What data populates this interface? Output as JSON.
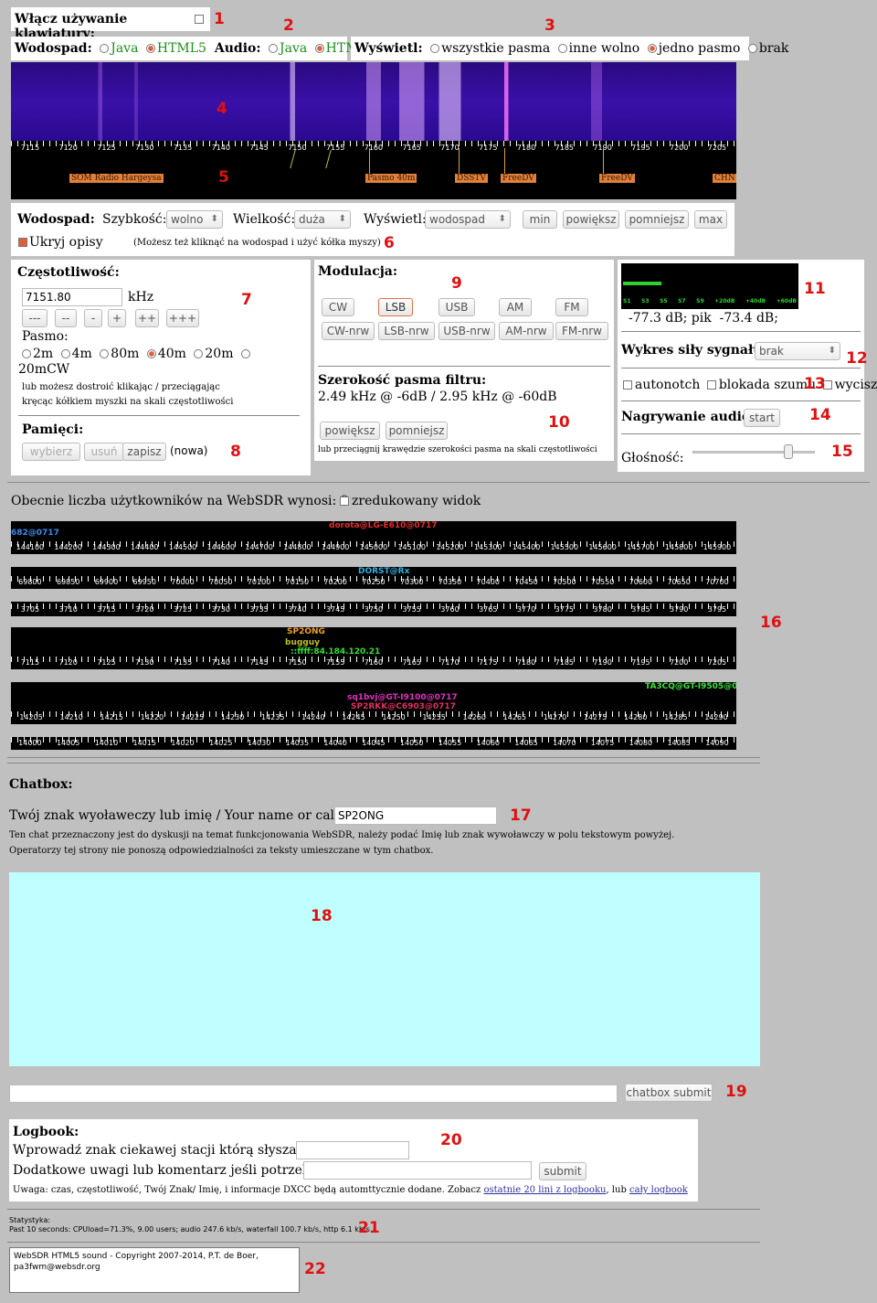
{
  "keyboard": {
    "label": "Włącz używanie klawiatury:"
  },
  "render": {
    "waterfall_label": "Wodospad:",
    "java": "Java",
    "html5": "HTML5",
    "audio_label": "Audio:"
  },
  "display": {
    "label": "Wyświetl:",
    "opts": [
      "wszystkie pasma",
      "inne wolno",
      "jedno pasmo",
      "brak"
    ]
  },
  "waterfall": {
    "ticks": [
      "7115",
      "7120",
      "7125",
      "7130",
      "7135",
      "7140",
      "7145",
      "7150",
      "7155",
      "7160",
      "7165",
      "7170",
      "7175",
      "7180",
      "7185",
      "7190",
      "7195",
      "7200",
      "7205"
    ],
    "labels": [
      "SOM Radio Hargeysa",
      "Pasmo 40m",
      "DSSTV",
      "FreeDV",
      "FreeDV",
      "CHN PBS Xinjiang"
    ]
  },
  "wf_settings": {
    "title": "Wodospad:",
    "speed_label": "Szybkość:",
    "speed": "wolno",
    "size_label": "Wielkość:",
    "size": "duża",
    "show_label": "Wyświetl:",
    "show": "wodospad",
    "btns": [
      "min",
      "powiększ",
      "pomniejsz",
      "max"
    ],
    "hide": "Ukryj opisy",
    "hint": "(Możesz też kliknąć na wodospad i użyć kółka myszy)"
  },
  "freq": {
    "title": "Częstotliwość:",
    "value": "7151.80",
    "unit": "kHz",
    "steps": [
      "---",
      "--",
      "-",
      "+",
      "++",
      "+++"
    ],
    "band_label": "Pasmo:",
    "bands": [
      "2m",
      "4m",
      "80m",
      "40m",
      "20m",
      "20mCW"
    ],
    "hint1": "lub możesz dostroić klikając / przeciągając",
    "hint2": "kręcąc kółkiem myszki na skali częstotliwości",
    "mem_title": "Pamięci:",
    "mem_btns": [
      "wybierz",
      "usuń",
      "zapisz"
    ],
    "mem_new": "(nowa)"
  },
  "mod": {
    "title": "Modulacja:",
    "row1": [
      "CW",
      "LSB",
      "USB",
      "AM",
      "FM"
    ],
    "row2": [
      "CW-nrw",
      "LSB-nrw",
      "USB-nrw",
      "AM-nrw",
      "FM-nrw"
    ],
    "bw_title": "Szerokość pasma filtru:",
    "bw_value": "2.49 kHz @ -6dB / 2.95 kHz @ -60dB",
    "bw_btns": [
      "powiększ",
      "pomniejsz"
    ],
    "bw_hint": "lub przeciągnij krawędzie szerokości pasma na skali częstotliwości"
  },
  "meter": {
    "scale": [
      "S1",
      "S3",
      "S5",
      "S7",
      "S9",
      "+20dB",
      "+40dB",
      "+60dB"
    ],
    "reading": "-77.3 dB; pik  -73.4 dB;",
    "level": 0.22
  },
  "signal": {
    "label": "Wykres siły sygnału:",
    "value": "brak",
    "autonotch": "autonotch",
    "nb": "blokada szumu",
    "mute": "wycisz",
    "rec_label": "Nagrywanie audio:",
    "rec_btn": "start",
    "vol_label": "Głośność:",
    "volume": 0.78
  },
  "users": {
    "text": "Obecnie liczba użytkowników na WebSDR wynosi: 9",
    "reduced": "zredukowany widok"
  },
  "bands": [
    {
      "ticks": [
        "144100",
        "144200",
        "144300",
        "144400",
        "144500",
        "144600",
        "144700",
        "144800",
        "144900",
        "145000",
        "145100",
        "145200",
        "145300",
        "145400",
        "145500",
        "145600",
        "145700",
        "145800",
        "145900"
      ],
      "users": [
        {
          "t": "682@0717",
          "c": "#3a8ef0"
        },
        {
          "t": "dorota@LG-E610@0717",
          "c": "#e03030"
        }
      ]
    },
    {
      "ticks": [
        "69800",
        "69850",
        "69900",
        "69950",
        "70000",
        "70050",
        "70100",
        "70150",
        "70200",
        "70250",
        "70300",
        "70350",
        "70400",
        "70450",
        "70500",
        "70550",
        "70600",
        "70650",
        "70700"
      ],
      "users": [
        {
          "t": "DORST@Rx",
          "c": "#30b0e0"
        }
      ]
    },
    {
      "ticks": [
        "3705",
        "3710",
        "3715",
        "3720",
        "3725",
        "3730",
        "3735",
        "3740",
        "3745",
        "3750",
        "3755",
        "3760",
        "3765",
        "3770",
        "3775",
        "3780",
        "3785",
        "3790",
        "3795"
      ],
      "users": []
    },
    {
      "ticks": [
        "7115",
        "7120",
        "7125",
        "7130",
        "7135",
        "7140",
        "7145",
        "7150",
        "7155",
        "7160",
        "7165",
        "7170",
        "7175",
        "7180",
        "7185",
        "7190",
        "7195",
        "7200",
        "7205"
      ],
      "users": [
        {
          "t": "SP2ONG",
          "c": "#f0a020"
        },
        {
          "t": "bugguy",
          "c": "#c0c020"
        },
        {
          "t": "::ffff:84.184.120.21",
          "c": "#30e030"
        }
      ]
    },
    {
      "ticks": [
        "14205",
        "14210",
        "14215",
        "14220",
        "14225",
        "14230",
        "14235",
        "14240",
        "14245",
        "14250",
        "14255",
        "14260",
        "14265",
        "14270",
        "14275",
        "14280",
        "14285",
        "14290"
      ],
      "users": [
        {
          "t": "TA3CQ@GT-I9505@0717",
          "c": "#40e040"
        },
        {
          "t": "sq1bvj@GT-I9100@0717",
          "c": "#e030c0"
        },
        {
          "t": "SP2RKK@C6903@0717",
          "c": "#e03060"
        }
      ]
    },
    {
      "ticks": [
        "14000",
        "14005",
        "14010",
        "14015",
        "14020",
        "14025",
        "14030",
        "14035",
        "14040",
        "14045",
        "14050",
        "14055",
        "14060",
        "14065",
        "14070",
        "14075",
        "14080",
        "14085",
        "14090"
      ],
      "users": []
    }
  ],
  "chat": {
    "title": "Chatbox:",
    "name_label": "Twój znak wyoławeczy lub imię / Your name or callsign:",
    "name_value": "SP2ONG",
    "note1": "Ten chat przeznaczony jest do dyskusji na temat funkcjonowania WebSDR, należy podać Imię lub znak wywoławczy w polu tekstowym powyżej.",
    "note2": "Operatorzy tej strony nie ponoszą odpowiedzialności za teksty umieszczane w tym chatbox.",
    "submit": "chatbox submit"
  },
  "logbook": {
    "title": "Logbook:",
    "station_label": "Wprowadź znak ciekawej stacji którą słyszałeś:",
    "comment_label": "Dodatkowe uwagi lub komentarz jeśli potrzebny:",
    "submit": "submit",
    "note": "Uwaga: czas, częstotliwość, Twój Znak/ Imię, i informacje DXCC będą automttycznie dodane. Zobacz",
    "link1": "ostatnie 20 lini z logbooku",
    "or": ", lub",
    "link2": "cały logbook"
  },
  "stats": {
    "title": "Statystyka:",
    "text": "Past 10 seconds: CPUload=71.3%, 9.00 users; audio 247.6 kb/s, waterfall 100.7 kb/s, http 6.1 kb/s"
  },
  "footer": {
    "line1": "WebSDR HTML5 sound - Copyright 2007-2014, P.T. de Boer,",
    "line2": "pa3fwm@websdr.org"
  },
  "markers": [
    "1",
    "2",
    "3",
    "4",
    "5",
    "6",
    "7",
    "8",
    "9",
    "10",
    "11",
    "12",
    "13",
    "14",
    "15",
    "16",
    "17",
    "18",
    "19",
    "20",
    "21",
    "22"
  ]
}
